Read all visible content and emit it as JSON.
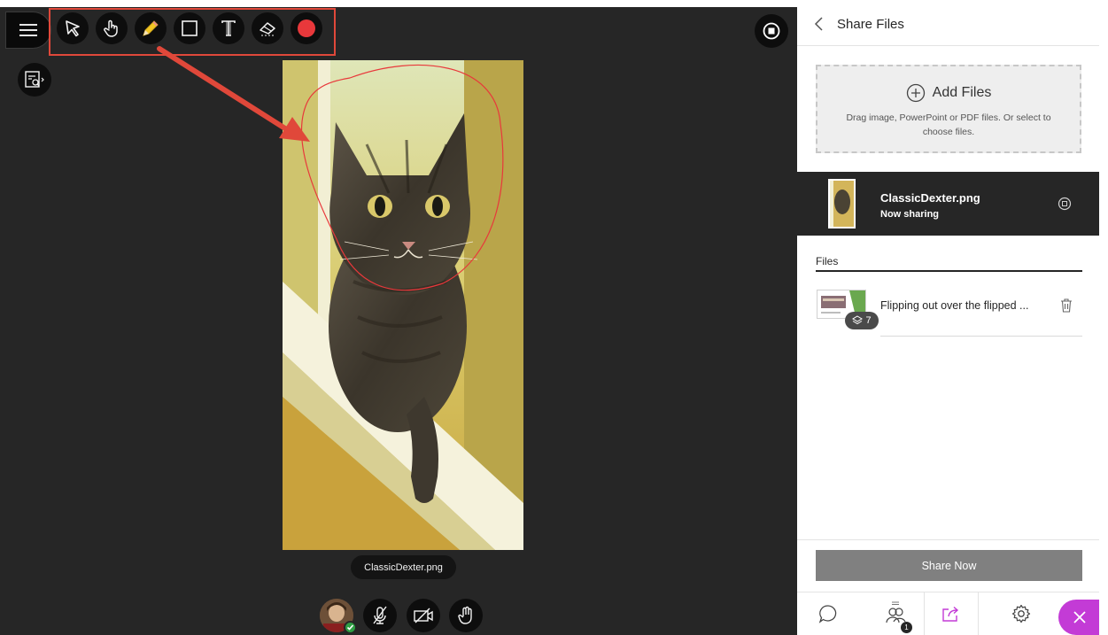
{
  "stage": {
    "tools": [
      {
        "icon": "pointer-icon"
      },
      {
        "icon": "hand-pan-icon"
      },
      {
        "icon": "pencil-icon"
      },
      {
        "icon": "square-shape-icon"
      },
      {
        "icon": "text-icon"
      },
      {
        "icon": "eraser-icon"
      },
      {
        "icon": "color-picker-icon",
        "color": "#e8383b"
      }
    ],
    "shared_image_caption": "ClassicDexter.png",
    "annotation_color": "#e8383b",
    "accent_red": "#e0483a"
  },
  "panel": {
    "title": "Share Files",
    "add_files": {
      "label": "Add Files",
      "hint": "Drag image, PowerPoint or PDF files. Or select to choose files."
    },
    "now_sharing": {
      "name": "ClassicDexter.png",
      "status": "Now sharing"
    },
    "files_heading": "Files",
    "files": [
      {
        "name": "Flipping out over the flipped ...",
        "pages": "7"
      }
    ],
    "share_now": "Share Now",
    "tabs": {
      "attendees_badge": "1"
    },
    "accent_purple": "#c33bd6"
  }
}
